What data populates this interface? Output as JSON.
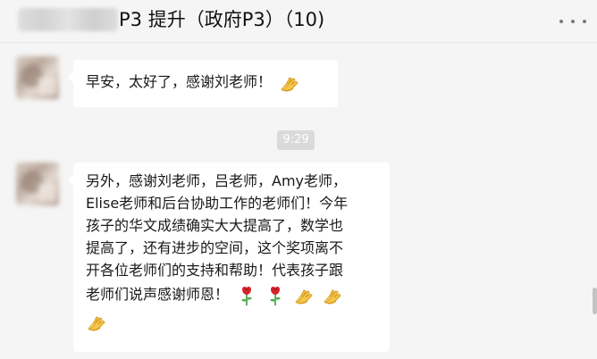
{
  "header": {
    "title": "P3 提升（政府P3）（10)"
  },
  "messages": [
    {
      "text": "早安，太好了，感谢刘老师！",
      "emoji": [
        "clap"
      ]
    },
    {
      "time": "9:29"
    },
    {
      "lines": [
        "另外，感谢刘老师，吕老师，Amy老师，",
        "Elise老师和后台协助工作的老师们！今年",
        "孩子的华文成绩确实大大提高了，数学也",
        "提高了，还有进步的空间，这个奖项离不",
        "开各位老师们的支持和帮助！代表孩子跟",
        "老师们说声感谢师恩！"
      ],
      "emoji": [
        "rose",
        "rose",
        "clap",
        "clap",
        "clap"
      ]
    }
  ],
  "colors": {
    "window_bg": "#f5f5f5",
    "bubble_bg": "#ffffff",
    "time_chip_bg": "#dadada",
    "text": "#191919"
  }
}
